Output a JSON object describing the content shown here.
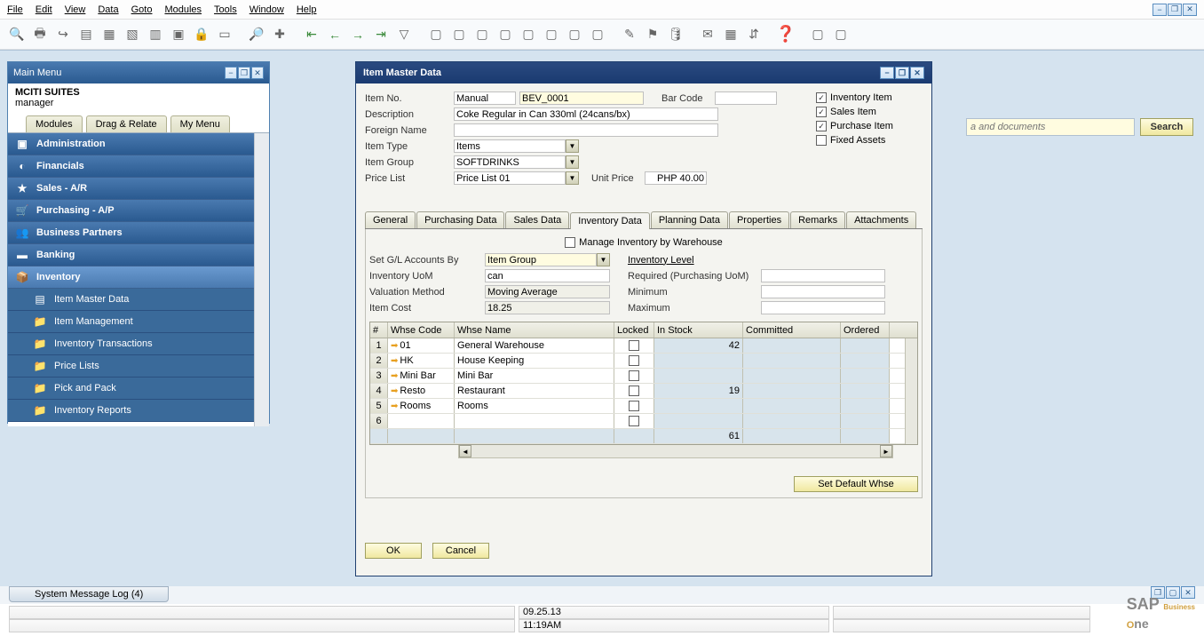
{
  "menubar": {
    "items": [
      "File",
      "Edit",
      "View",
      "Data",
      "Goto",
      "Modules",
      "Tools",
      "Window",
      "Help"
    ]
  },
  "search": {
    "placeholder": "a and documents",
    "button": "Search"
  },
  "main_menu": {
    "title": "Main Menu",
    "company": "MCITI SUITES",
    "user": "manager",
    "tabs": [
      "Modules",
      "Drag & Relate",
      "My Menu"
    ],
    "modules": [
      "Administration",
      "Financials",
      "Sales - A/R",
      "Purchasing - A/P",
      "Business Partners",
      "Banking",
      "Inventory"
    ],
    "inventory_items": [
      "Item Master Data",
      "Item Management",
      "Inventory Transactions",
      "Price Lists",
      "Pick and Pack",
      "Inventory Reports"
    ]
  },
  "imd": {
    "title": "Item Master Data",
    "labels": {
      "item_no": "Item No.",
      "desc": "Description",
      "foreign": "Foreign Name",
      "item_type": "Item Type",
      "item_group": "Item Group",
      "price_list": "Price List",
      "bar_code": "Bar Code",
      "unit_price": "Unit Price"
    },
    "values": {
      "item_no_mode": "Manual",
      "item_no": "BEV_0001",
      "desc": "Coke Regular in Can 330ml (24cans/bx)",
      "foreign": "",
      "item_type": "Items",
      "item_group": "SOFTDRINKS",
      "price_list": "Price List 01",
      "bar_code": "",
      "unit_price": "PHP 40.00"
    },
    "checks": {
      "inventory_item": "Inventory Item",
      "sales_item": "Sales Item",
      "purchase_item": "Purchase Item",
      "fixed_assets": "Fixed Assets"
    },
    "tabs": [
      "General",
      "Purchasing Data",
      "Sales Data",
      "Inventory Data",
      "Planning Data",
      "Properties",
      "Remarks",
      "Attachments"
    ],
    "inv": {
      "manage_by_whse": "Manage Inventory by Warehouse",
      "set_gl": "Set G/L Accounts By",
      "set_gl_val": "Item Group",
      "uom": "Inventory UoM",
      "uom_val": "can",
      "val_method": "Valuation Method",
      "val_method_val": "Moving Average",
      "item_cost": "Item Cost",
      "item_cost_val": "18.25",
      "inv_level": "Inventory Level",
      "required": "Required (Purchasing UoM)",
      "minimum": "Minimum",
      "maximum": "Maximum",
      "cols": [
        "#",
        "Whse Code",
        "Whse Name",
        "Locked",
        "In Stock",
        "Committed",
        "Ordered"
      ],
      "rows": [
        {
          "n": "1",
          "code": "01",
          "name": "General Warehouse",
          "locked": false,
          "in_stock": "42",
          "committed": "",
          "ordered": ""
        },
        {
          "n": "2",
          "code": "HK",
          "name": "House Keeping",
          "locked": false,
          "in_stock": "",
          "committed": "",
          "ordered": ""
        },
        {
          "n": "3",
          "code": "Mini Bar",
          "name": "Mini Bar",
          "locked": false,
          "in_stock": "",
          "committed": "",
          "ordered": ""
        },
        {
          "n": "4",
          "code": "Resto",
          "name": "Restaurant",
          "locked": false,
          "in_stock": "19",
          "committed": "",
          "ordered": ""
        },
        {
          "n": "5",
          "code": "Rooms",
          "name": "Rooms",
          "locked": false,
          "in_stock": "",
          "committed": "",
          "ordered": ""
        },
        {
          "n": "6",
          "code": "",
          "name": "",
          "locked": false,
          "in_stock": "",
          "committed": "",
          "ordered": ""
        }
      ],
      "total_in_stock": "61",
      "set_default": "Set Default Whse"
    },
    "buttons": {
      "ok": "OK",
      "cancel": "Cancel"
    }
  },
  "msglog": "System Message Log (4)",
  "status": {
    "date": "09.25.13",
    "time": "11:19AM"
  }
}
